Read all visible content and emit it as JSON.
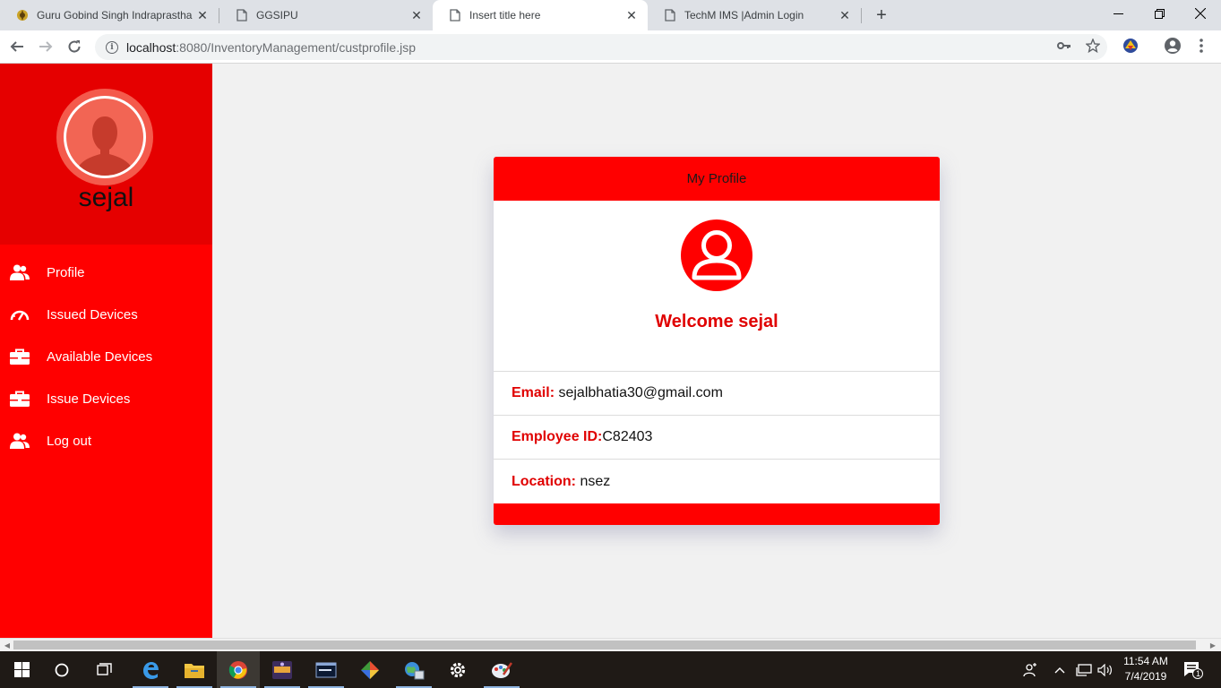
{
  "browser": {
    "tabs": [
      {
        "title": "Guru Gobind Singh Indraprastha",
        "active": false
      },
      {
        "title": "GGSIPU",
        "active": false
      },
      {
        "title": "Insert title here",
        "active": true
      },
      {
        "title": "TechM IMS |Admin Login",
        "active": false
      }
    ],
    "close_glyph": "✕",
    "newtab_glyph": "+",
    "url_host": "localhost",
    "url_path": ":8080/InventoryManagement/custprofile.jsp",
    "window_controls": {
      "minimize": "—",
      "restore": "❐",
      "close": "✕"
    }
  },
  "sidebar": {
    "username": "sejal",
    "items": [
      {
        "label": "Profile",
        "icon": "users-icon"
      },
      {
        "label": "Issued Devices",
        "icon": "speedometer-icon"
      },
      {
        "label": "Available Devices",
        "icon": "briefcase-icon"
      },
      {
        "label": "Issue Devices",
        "icon": "briefcase-icon"
      },
      {
        "label": "Log out",
        "icon": "users-icon"
      }
    ]
  },
  "card": {
    "header": "My Profile",
    "welcome": "Welcome sejal",
    "rows": [
      {
        "label": "Email:",
        "value": " sejalbhatia30@gmail.com"
      },
      {
        "label": "Employee ID:",
        "value": "C82403"
      },
      {
        "label": "Location:",
        "value": " nsez"
      }
    ]
  },
  "taskbar": {
    "time": "11:54 AM",
    "date": "7/4/2019",
    "notification_count": "1"
  },
  "colors": {
    "primary_red": "#ff0000",
    "sidebar_head": "#e50000",
    "label_red": "#e00000",
    "page_bg": "#f1f1f1"
  }
}
